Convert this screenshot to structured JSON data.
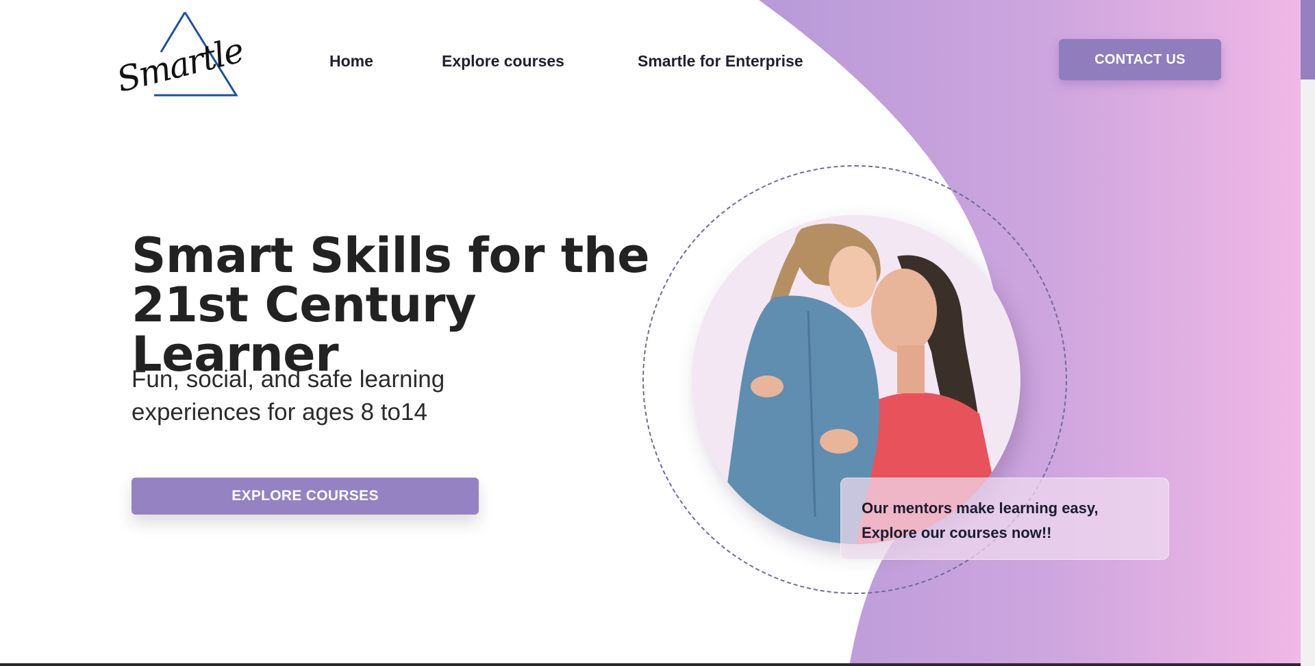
{
  "brand": {
    "logo_text": "Smartle"
  },
  "nav": {
    "items": [
      {
        "label": "Home"
      },
      {
        "label": "Explore courses"
      },
      {
        "label": "Smartle for Enterprise"
      }
    ],
    "contact_label": "CONTACT US"
  },
  "hero": {
    "title_line1": "Smart Skills for the",
    "title_line2": "21st Century Learner",
    "subtitle_line1": "Fun, social, and safe learning",
    "subtitle_line2": "experiences for ages 8 to14",
    "cta_label": "EXPLORE COURSES"
  },
  "mentor_card": {
    "line1": "Our mentors make learning easy,",
    "line2": "Explore our courses now!!"
  },
  "colors": {
    "accent": "#9582c2",
    "gradient_start": "#b79ad8",
    "gradient_end": "#f0b8e6",
    "heading": "#222222"
  }
}
